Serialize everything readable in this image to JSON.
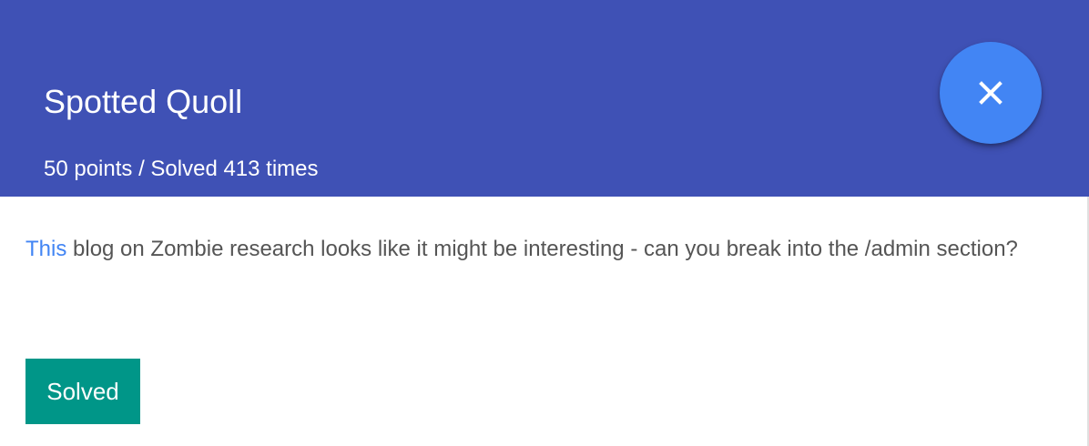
{
  "challenge": {
    "title": "Spotted Quoll",
    "subtitle": "50 points / Solved 413 times",
    "description": {
      "link_text": "This",
      "text": " blog on Zombie research looks like it might be interesting - can you break into the /admin section?"
    },
    "status_button_label": "Solved"
  },
  "icons": {
    "close": "close-icon"
  },
  "colors": {
    "header_background": "#3f51b5",
    "close_button": "#4285f4",
    "link": "#4285f4",
    "solved_button": "#009688",
    "body_text": "#555555"
  }
}
